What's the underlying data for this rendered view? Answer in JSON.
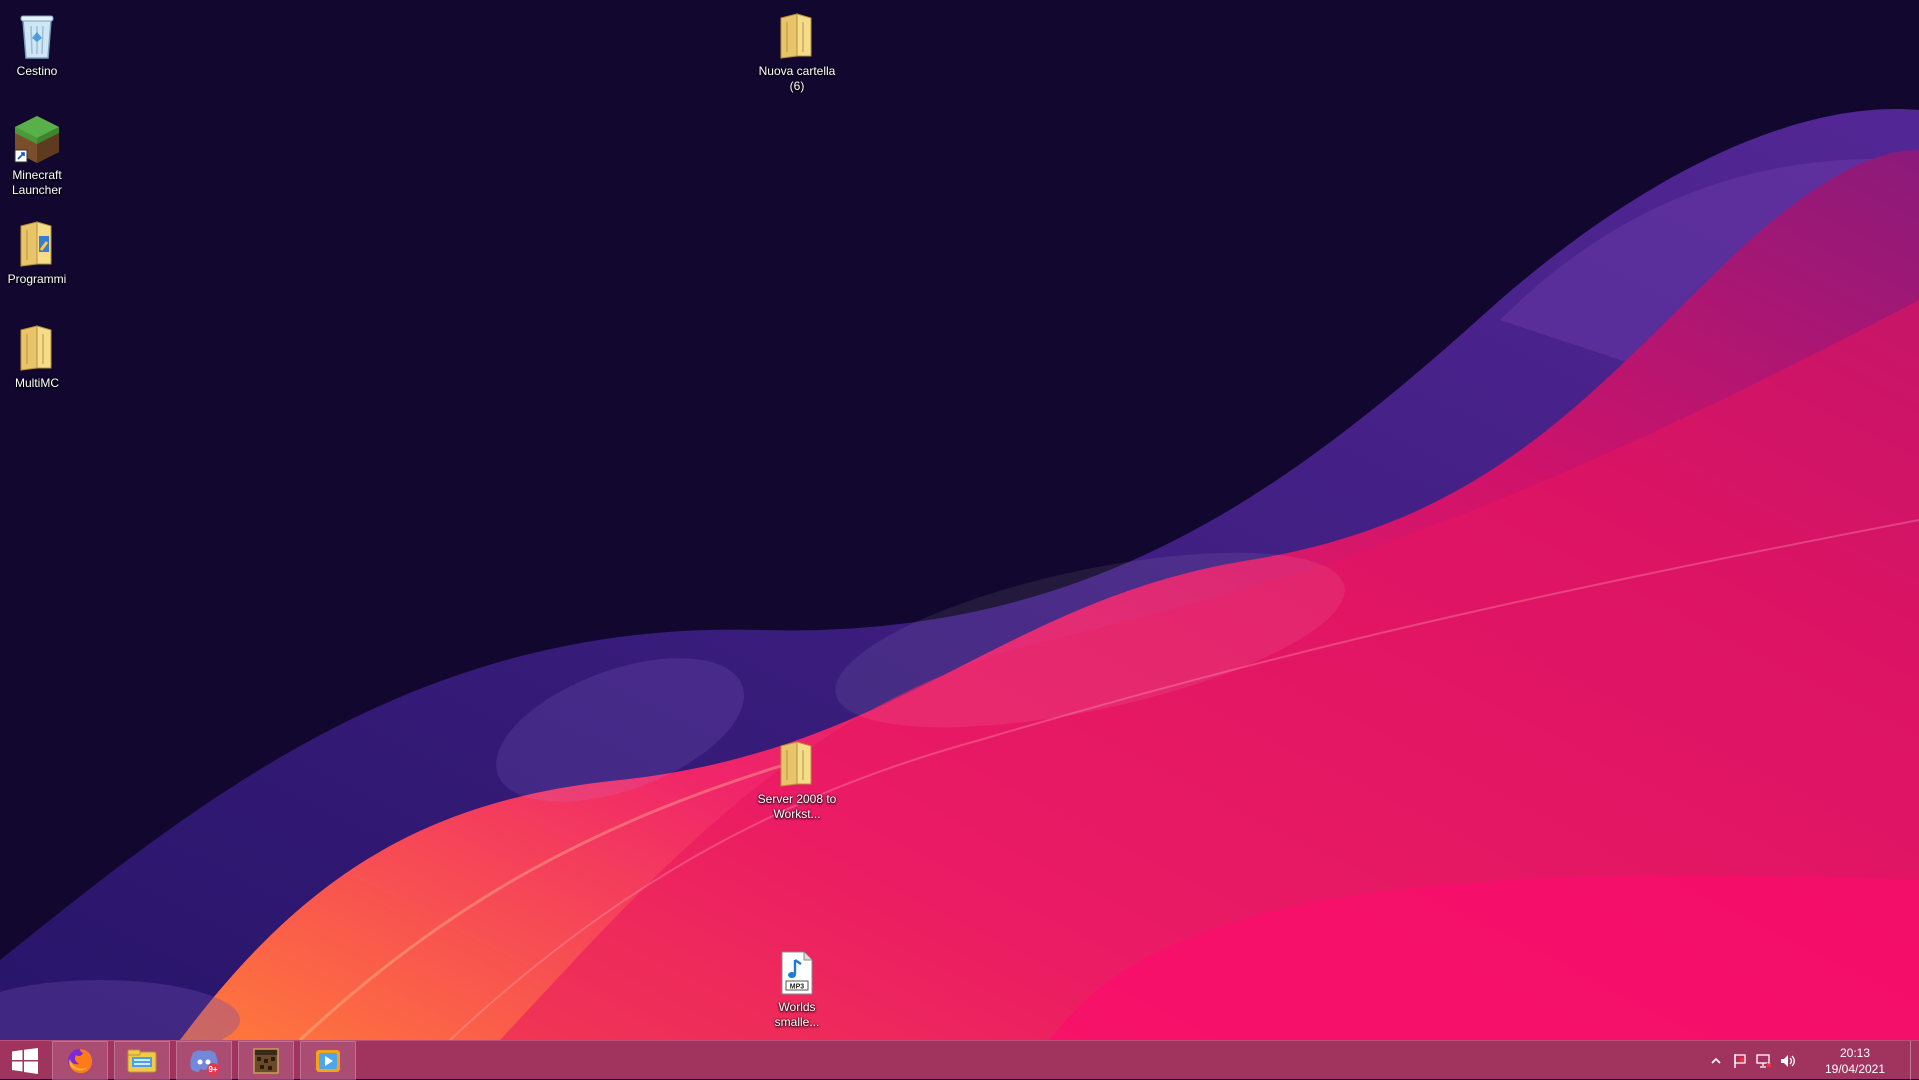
{
  "desktop": {
    "icons": [
      {
        "label": "Cestino",
        "icon": "recycle-bin-icon"
      },
      {
        "label": "Minecraft Launcher",
        "icon": "minecraft-launcher-icon"
      },
      {
        "label": "Programmi",
        "icon": "folder-icon"
      },
      {
        "label": "MultiMC",
        "icon": "folder-icon"
      },
      {
        "label": "Nuova cartella (6)",
        "icon": "folder-icon"
      },
      {
        "label": "Server 2008 to Workst...",
        "icon": "folder-icon"
      },
      {
        "label": "Worlds smalle...",
        "icon": "mp3-file-icon",
        "badge": "MP3"
      }
    ]
  },
  "taskbar": {
    "buttons": [
      {
        "name": "start",
        "icon": "windows-logo-icon"
      },
      {
        "name": "firefox",
        "icon": "firefox-icon"
      },
      {
        "name": "file-explorer",
        "icon": "file-explorer-icon"
      },
      {
        "name": "discord",
        "icon": "discord-icon",
        "badge": "9+"
      },
      {
        "name": "minecraft",
        "icon": "minecraft-icon"
      },
      {
        "name": "media-player",
        "icon": "media-player-icon"
      }
    ],
    "tray": {
      "icons": [
        "chevron-up-icon",
        "flag-icon",
        "network-icon",
        "volume-icon"
      ],
      "time": "20:13",
      "date": "19/04/2021"
    }
  },
  "colors": {
    "background": "#12082f",
    "taskbar": "#a0345f",
    "wave_magenta": "#e0106a",
    "wave_indigo": "#3a1a8a"
  }
}
